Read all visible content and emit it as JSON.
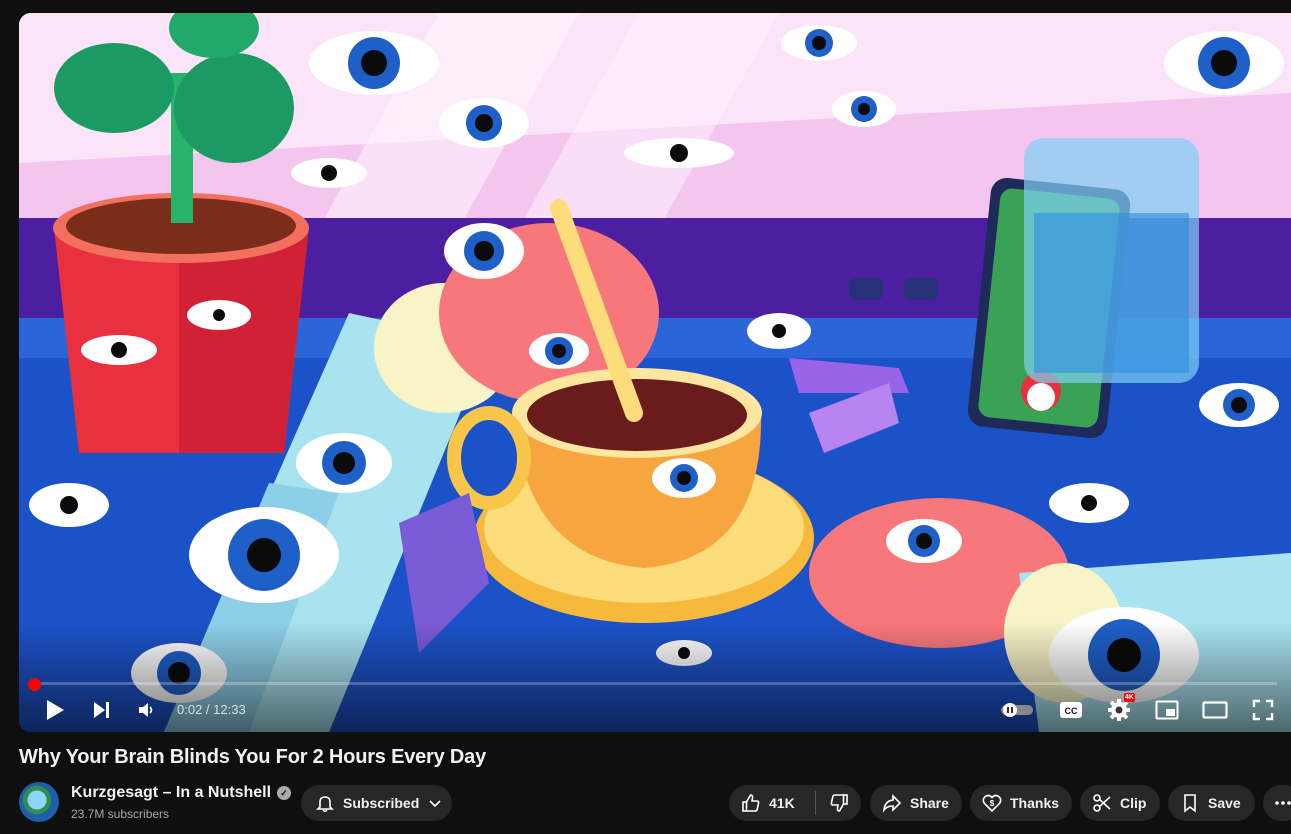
{
  "video": {
    "time_display": "0:02 / 12:33",
    "progress_fraction": 0.003,
    "quality_badge": "4K"
  },
  "title": "Why Your Brain Blinds You For 2 Hours Every Day",
  "channel": {
    "name": "Kurzgesagt – In a Nutshell",
    "subscribers": "23.7M subscribers",
    "verified_icon": "check-icon"
  },
  "actions": {
    "subscribe_label": "Subscribed",
    "like_count": "41K",
    "share_label": "Share",
    "thanks_label": "Thanks",
    "clip_label": "Clip",
    "save_label": "Save"
  },
  "colors": {
    "background": "#0f0f0f",
    "pill": "#272727",
    "progress": "#ff0000",
    "text": "#f1f1f1",
    "secondary_text": "#aaaaaa"
  }
}
